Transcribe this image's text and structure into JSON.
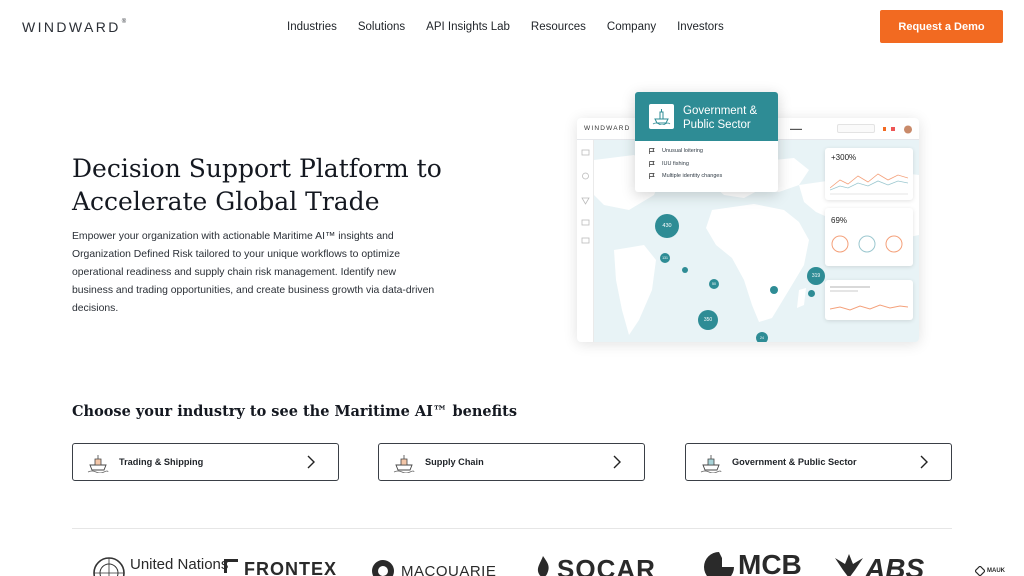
{
  "header": {
    "logo": "WINDWARD",
    "nav": [
      "Industries",
      "Solutions",
      "API Insights Lab",
      "Resources",
      "Company",
      "Investors"
    ],
    "cta": "Request a Demo"
  },
  "hero": {
    "title": "Decision Support Platform to Accelerate Global Trade",
    "description": "Empower your organization with actionable Maritime AI™ insights and Organization Defined Risk tailored to your unique workflows to optimize operational readiness and supply chain risk management. Identify new business and trading opportunities, and create business growth via data-driven decisions."
  },
  "dashboard": {
    "logo": "WINDWARD",
    "clusters": [
      "430",
      "131",
      "50",
      "350",
      "24",
      "319"
    ],
    "stat_1": "+300%",
    "stat_2": "69%"
  },
  "gov_card": {
    "title": "Government & Public Sector",
    "items": [
      "Unusual loitering",
      "IUU fishing",
      "Multiple identity changes"
    ]
  },
  "industries": {
    "title": "Choose your industry to see the Maritime AI™ benefits",
    "cards": [
      "Trading & Shipping",
      "Supply Chain",
      "Government & Public Sector"
    ]
  },
  "partners": [
    "United Nations",
    "FRONTEX",
    "MACQUARIE",
    "SOCAR",
    "MCB",
    "ABS",
    "MAUK"
  ],
  "colors": {
    "accent": "#f26a21",
    "teal": "#2e8c95"
  }
}
